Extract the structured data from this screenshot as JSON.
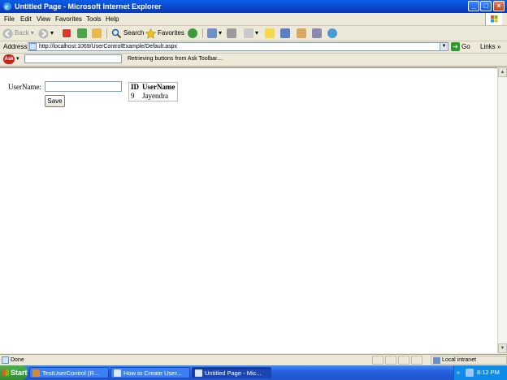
{
  "window": {
    "title": "Untitled Page - Microsoft Internet Explorer",
    "min": "_",
    "max": "□",
    "close": "×"
  },
  "menu": [
    "File",
    "Edit",
    "View",
    "Favorites",
    "Tools",
    "Help"
  ],
  "toolbar": {
    "back": "Back",
    "search": "Search",
    "favorites": "Favorites"
  },
  "address": {
    "label": "Address",
    "url": "http://localhost:1069/UserControlExample/Default.aspx",
    "go": "Go",
    "links": "Links",
    "links_chevron": "»"
  },
  "ask": {
    "logo": "Ask",
    "status": "Retrieving buttons from Ask Toolbar...."
  },
  "form": {
    "label": "UserName:",
    "input_value": "",
    "button": "Save"
  },
  "grid": {
    "headers": [
      "ID",
      "UserName"
    ],
    "rows": [
      [
        "9",
        "Jayendra"
      ]
    ]
  },
  "status": {
    "text": "Done",
    "zone": "Local intranet"
  },
  "taskbar": {
    "start": "Start",
    "tasks": [
      {
        "label": "TestUserControl (R...",
        "active": false
      },
      {
        "label": "How to Create User...",
        "active": false
      },
      {
        "label": "Untitled Page - Mic...",
        "active": true
      }
    ],
    "chevron": "«",
    "clock": "8:12 PM"
  },
  "colors": {
    "titlebar": "#0b44c7",
    "taskbar": "#245edb",
    "start": "#2f8f2f",
    "tray": "#0f8be8"
  },
  "icons": [
    "ie-icon",
    "back-icon",
    "forward-icon",
    "stop-icon",
    "refresh-icon",
    "home-icon",
    "search-icon",
    "favorites-star-icon",
    "history-icon",
    "mail-icon",
    "print-icon",
    "edit-icon",
    "discuss-icon",
    "messenger-icon",
    "go-icon",
    "ask-logo-icon"
  ]
}
